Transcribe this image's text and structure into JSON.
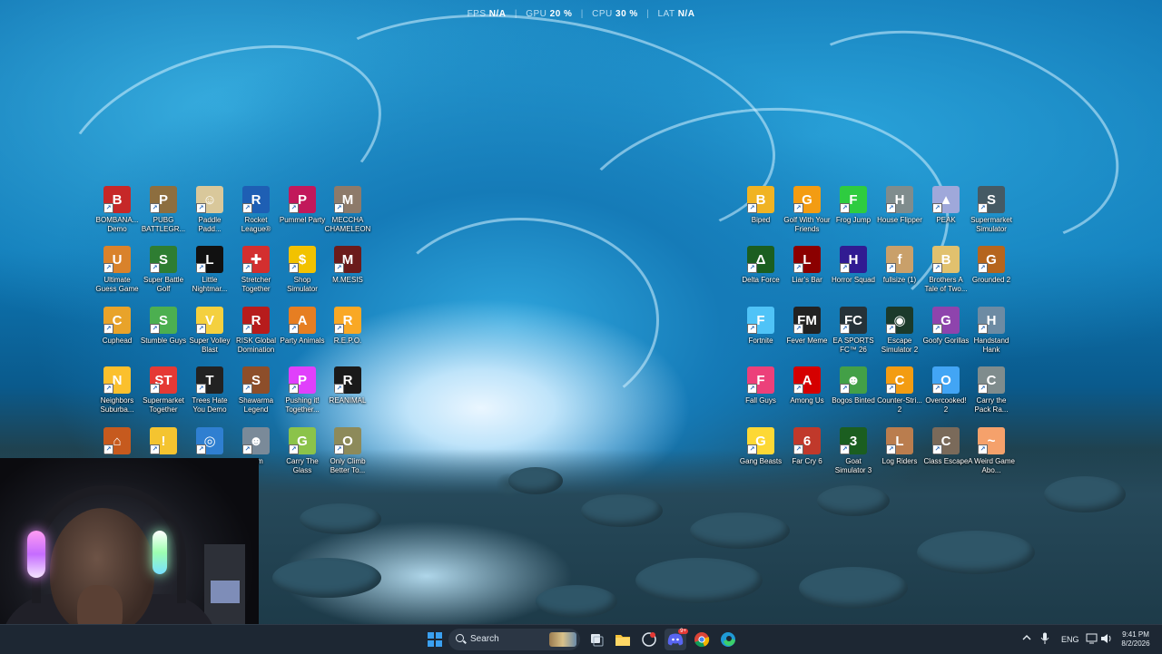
{
  "overlay": {
    "fps_label": "FPS",
    "fps_value": "N/A",
    "gpu_label": "GPU",
    "gpu_value": "20 %",
    "cpu_label": "CPU",
    "cpu_value": "30 %",
    "lat_label": "LAT",
    "lat_value": "N/A",
    "separator": "|"
  },
  "desktop_icons": [
    {
      "label": "BOMBANA... Demo",
      "glyph": "B",
      "color": "#c62828"
    },
    {
      "label": "PUBG BATTLEGR...",
      "glyph": "P",
      "color": "#8d6e3f"
    },
    {
      "label": "Paddle Padd...",
      "glyph": "☺",
      "color": "#d9c89b"
    },
    {
      "label": "Rocket League®",
      "glyph": "R",
      "color": "#1e5fb4"
    },
    {
      "label": "Pummel Party",
      "glyph": "P",
      "color": "#c2185b"
    },
    {
      "label": "MECCHA CHAMELEON",
      "glyph": "M",
      "color": "#8d7a6a"
    },
    {
      "label": "Ultimate Guess Game",
      "glyph": "U",
      "color": "#d9822b"
    },
    {
      "label": "Super Battle Golf",
      "glyph": "S",
      "color": "#2e7d32"
    },
    {
      "label": "Little Nightmar...",
      "glyph": "L",
      "color": "#111111"
    },
    {
      "label": "Stretcher Together",
      "glyph": "✚",
      "color": "#d32f2f"
    },
    {
      "label": "Shop Simulator",
      "glyph": "$",
      "color": "#f2c200"
    },
    {
      "label": "M.MESIS",
      "glyph": "M",
      "color": "#6b1b1b"
    },
    {
      "label": "Cuphead",
      "glyph": "C",
      "color": "#e8a32a"
    },
    {
      "label": "Stumble Guys",
      "glyph": "S",
      "color": "#4caf50"
    },
    {
      "label": "Super Volley Blast",
      "glyph": "V",
      "color": "#f4d03f"
    },
    {
      "label": "RISK Global Domination",
      "glyph": "R",
      "color": "#b71c1c"
    },
    {
      "label": "Party Animals",
      "glyph": "A",
      "color": "#e67e22"
    },
    {
      "label": "R.E.P.O.",
      "glyph": "R",
      "color": "#f9a825"
    },
    {
      "label": "Neighbors Suburba...",
      "glyph": "N",
      "color": "#fbc02d"
    },
    {
      "label": "Supermarket Together",
      "glyph": "ST",
      "color": "#e53935"
    },
    {
      "label": "Trees Hate You Demo",
      "glyph": "T",
      "color": "#222222"
    },
    {
      "label": "Shawarma Legend",
      "glyph": "S",
      "color": "#8d4e2a"
    },
    {
      "label": "Pushing it! Together...",
      "glyph": "P",
      "color": "#e040fb"
    },
    {
      "label": "REANIMAL",
      "glyph": "R",
      "color": "#1a1a1a"
    },
    {
      "label": "",
      "glyph": "⌂",
      "color": "#c65a1e"
    },
    {
      "label": "",
      "glyph": "!",
      "color": "#f4c430"
    },
    {
      "label": "",
      "glyph": "◎",
      "color": "#2f7fd1"
    },
    {
      "label": "eam",
      "glyph": "☻",
      "color": "#7a8a99"
    },
    {
      "label": "Carry The Glass",
      "glyph": "G",
      "color": "#8bc34a"
    },
    {
      "label": "Only Climb Better To...",
      "glyph": "O",
      "color": "#8d8a5a"
    },
    {
      "label": "Biped",
      "glyph": "B",
      "color": "#f0b323"
    },
    {
      "label": "Golf With Your Friends",
      "glyph": "G",
      "color": "#f39c12"
    },
    {
      "label": "Frog Jump",
      "glyph": "F",
      "color": "#2ecc40"
    },
    {
      "label": "House Flipper",
      "glyph": "H",
      "color": "#7f8c8d"
    },
    {
      "label": "PEAK",
      "glyph": "▲",
      "color": "#9fa8da"
    },
    {
      "label": "Supermarket Simulator",
      "glyph": "S",
      "color": "#455a64"
    },
    {
      "label": "Delta Force",
      "glyph": "Δ",
      "color": "#1b5e20"
    },
    {
      "label": "Liar's Bar",
      "glyph": "L",
      "color": "#8b0000"
    },
    {
      "label": "Horror Squad",
      "glyph": "H",
      "color": "#311b92"
    },
    {
      "label": "fullsize (1)",
      "glyph": "f",
      "color": "#c9a06a"
    },
    {
      "label": "Brothers A Tale of Two...",
      "glyph": "B",
      "color": "#e1c16e"
    },
    {
      "label": "Grounded 2",
      "glyph": "G",
      "color": "#b5651d"
    },
    {
      "label": "Fortnite",
      "glyph": "F",
      "color": "#4fc3f7"
    },
    {
      "label": "Fever Meme",
      "glyph": "FM",
      "color": "#222222"
    },
    {
      "label": "EA SPORTS FC™ 26",
      "glyph": "FC",
      "color": "#263238"
    },
    {
      "label": "Escape Simulator 2",
      "glyph": "◉",
      "color": "#1b3a2b"
    },
    {
      "label": "Goofy Gorillas",
      "glyph": "G",
      "color": "#8e44ad"
    },
    {
      "label": "Handstand Hank",
      "glyph": "H",
      "color": "#6d8ba3"
    },
    {
      "label": "Fall Guys",
      "glyph": "F",
      "color": "#ec407a"
    },
    {
      "label": "Among Us",
      "glyph": "A",
      "color": "#d50000"
    },
    {
      "label": "Bogos Binted",
      "glyph": "☻",
      "color": "#43a047"
    },
    {
      "label": "Counter-Stri... 2",
      "glyph": "C",
      "color": "#f39c12"
    },
    {
      "label": "Overcooked! 2",
      "glyph": "O",
      "color": "#42a5f5"
    },
    {
      "label": "Carry the Pack Ra...",
      "glyph": "C",
      "color": "#7f8c8d"
    },
    {
      "label": "Gang Beasts",
      "glyph": "G",
      "color": "#fdd835"
    },
    {
      "label": "Far Cry 6",
      "glyph": "6",
      "color": "#c0392b"
    },
    {
      "label": "Goat Simulator 3",
      "glyph": "3",
      "color": "#1b5e20"
    },
    {
      "label": "Log Riders",
      "glyph": "L",
      "color": "#ba7d4e"
    },
    {
      "label": "Class Escape",
      "glyph": "C",
      "color": "#7a6a5a"
    },
    {
      "label": "A Weird Game Abo...",
      "glyph": "~",
      "color": "#f5a16b"
    }
  ],
  "taskbar": {
    "search_placeholder": "Search",
    "discord_badge": "9+",
    "language": "ENG",
    "time": "9:41 PM",
    "date": "8/2/2026"
  }
}
